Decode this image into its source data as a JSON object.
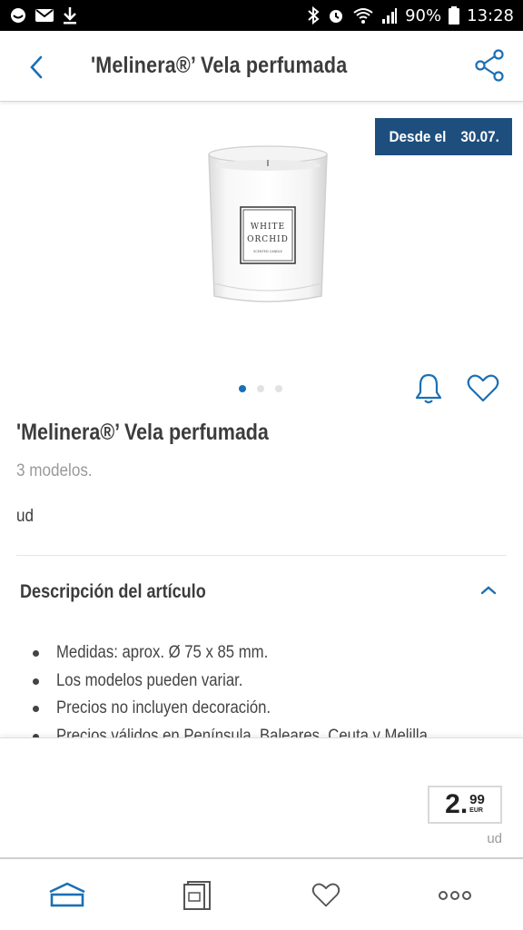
{
  "status_bar": {
    "battery": "90%",
    "time": "13:28"
  },
  "header": {
    "title": "'Melinera®’ Vela perfumada"
  },
  "badge": {
    "prefix": "Desde el",
    "date": "30.07."
  },
  "product_image": {
    "label_line1": "WHITE",
    "label_line2": "ORCHID",
    "label_line3": "SCENTED CANDLE"
  },
  "carousel": {
    "total_dots": 3,
    "active_index": 0
  },
  "product": {
    "title": "'Melinera®’ Vela perfumada",
    "models": "3 modelos.",
    "unit": "ud"
  },
  "description": {
    "title": "Descripción del artículo",
    "items": [
      "Medidas: aprox. Ø 75 x 85 mm.",
      "Los modelos pueden variar.",
      "Precios no incluyen decoración.",
      "Precios válidos en Península, Baleares, Ceuta y Melilla."
    ]
  },
  "price": {
    "integer": "2.",
    "decimals": "99",
    "currency": "EUR",
    "unit": "ud"
  },
  "bottom_nav": {
    "items": [
      "home-icon",
      "leaflet-icon",
      "heart-icon",
      "more-icon"
    ]
  },
  "colors": {
    "accent_blue": "#1b6fb5",
    "badge_bg": "#1e4e7d",
    "text_dark": "#3c3c3c",
    "text_muted": "#9a9a9a"
  }
}
